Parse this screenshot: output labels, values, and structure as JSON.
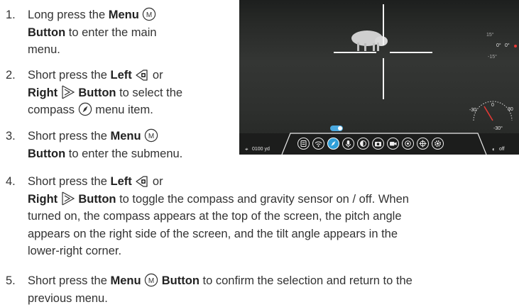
{
  "steps": [
    {
      "num": "1.",
      "l1": [
        "Long press the ",
        "Menu"
      ],
      "l2": [
        "Button",
        " to enter the main"
      ],
      "l3": "menu."
    },
    {
      "num": "2.",
      "l1": [
        "Short press the ",
        "Left",
        " or"
      ],
      "l2": [
        "Right ",
        "Button",
        " to select the"
      ],
      "l3": [
        "compass ",
        "menu item."
      ]
    },
    {
      "num": "3.",
      "l1": [
        "Short press the ",
        "Menu"
      ],
      "l2": [
        "Button",
        " to enter the submenu."
      ]
    },
    {
      "num": "4.",
      "l1": [
        "Short press the ",
        "Left",
        " or"
      ],
      "l2": [
        "Right ",
        "Button",
        " to toggle the compass and gravity sensor on / off. When"
      ],
      "l3": "turned on, the compass appears at the top of the screen, the pitch angle",
      "l4": "appears on the right side of the screen, and the tilt angle appears in the",
      "l5": "lower-right corner."
    },
    {
      "num": "5.",
      "l1": [
        "Short press the ",
        "Menu",
        "Button",
        " to confirm the selection and return to the"
      ],
      "l2": "previous menu."
    }
  ],
  "screen": {
    "distance": "0100 yd",
    "status": "off",
    "pitch_top": "15°",
    "pitch_value": "0°",
    "pitch_value_b": "0°",
    "pitch_bottom": "-15°",
    "tilt_left": "-30",
    "tilt_mid": "0",
    "tilt_right": "30",
    "tilt_value": "-30°"
  },
  "icons": [
    "menu-circle-m-icon",
    "left-camera-button-icon",
    "right-arrow-button-icon",
    "compass-icon",
    "brightness-icon",
    "wifi-icon",
    "compass-icon",
    "microphone-icon",
    "color-mode-icon",
    "camera-icon",
    "video-icon",
    "calibration-icon",
    "crosshair-icon",
    "settings-icon"
  ]
}
